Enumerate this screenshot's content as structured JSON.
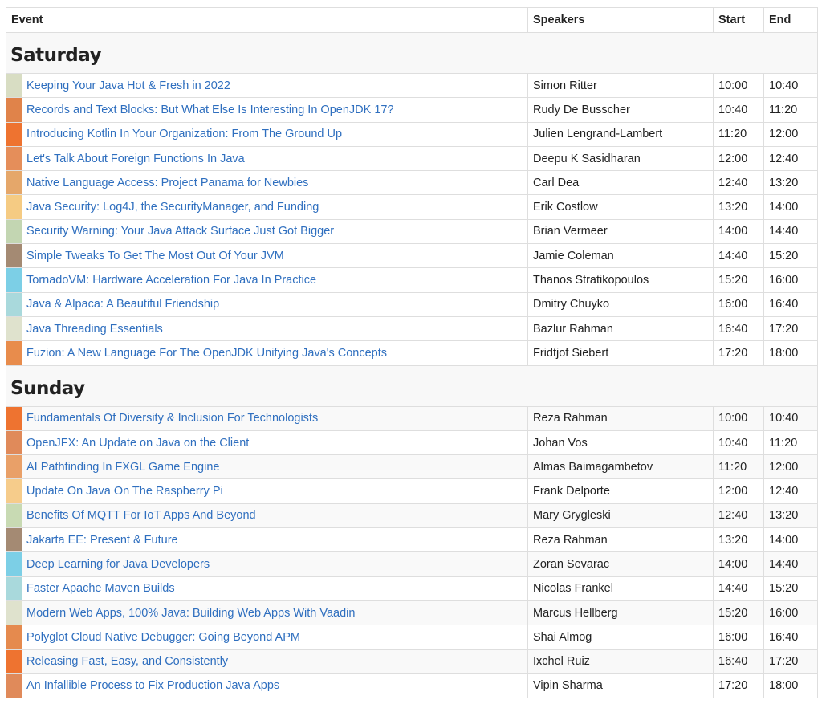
{
  "headers": {
    "event": "Event",
    "speakers": "Speakers",
    "start": "Start",
    "end": "End"
  },
  "days": [
    {
      "name": "Saturday",
      "events": [
        {
          "title": "Keeping Your Java Hot & Fresh in 2022",
          "speaker": "Simon Ritter",
          "start": "10:00",
          "end": "10:40",
          "color": "#d8ddc3"
        },
        {
          "title": "Records and Text Blocks: But What Else Is Interesting In OpenJDK 17?",
          "speaker": "Rudy De Busscher",
          "start": "10:40",
          "end": "11:20",
          "color": "#e0834a"
        },
        {
          "title": "Introducing Kotlin In Your Organization: From The Ground Up",
          "speaker": "Julien Lengrand-Lambert",
          "start": "11:20",
          "end": "12:00",
          "color": "#ee7330"
        },
        {
          "title": "Let's Talk About Foreign Functions In Java",
          "speaker": "Deepu K Sasidharan",
          "start": "12:00",
          "end": "12:40",
          "color": "#e58e5a"
        },
        {
          "title": "Native Language Access: Project Panama for Newbies",
          "speaker": "Carl Dea",
          "start": "12:40",
          "end": "13:20",
          "color": "#e5a76a"
        },
        {
          "title": "Java Security: Log4J, the SecurityManager, and Funding",
          "speaker": "Erik Costlow",
          "start": "13:20",
          "end": "14:00",
          "color": "#f5cb83"
        },
        {
          "title": "Security Warning: Your Java Attack Surface Just Got Bigger",
          "speaker": "Brian Vermeer",
          "start": "14:00",
          "end": "14:40",
          "color": "#c3d6b2"
        },
        {
          "title": "Simple Tweaks To Get The Most Out Of Your JVM",
          "speaker": "Jamie Coleman",
          "start": "14:40",
          "end": "15:20",
          "color": "#a48a73"
        },
        {
          "title": "TornadoVM: Hardware Acceleration For Java In Practice",
          "speaker": "Thanos Stratikopoulos",
          "start": "15:20",
          "end": "16:00",
          "color": "#7ccfe6"
        },
        {
          "title": "Java & Alpaca: A Beautiful Friendship",
          "speaker": "Dmitry Chuyko",
          "start": "16:00",
          "end": "16:40",
          "color": "#a9d9dc"
        },
        {
          "title": "Java Threading Essentials",
          "speaker": "Bazlur Rahman",
          "start": "16:40",
          "end": "17:20",
          "color": "#dfe2cd"
        },
        {
          "title": "Fuzion: A New Language For The OpenJDK Unifying Java's Concepts",
          "speaker": "Fridtjof Siebert",
          "start": "17:20",
          "end": "18:00",
          "color": "#e88c4c"
        }
      ]
    },
    {
      "name": "Sunday",
      "events": [
        {
          "title": "Fundamentals Of Diversity & Inclusion For Technologists",
          "speaker": "Reza Rahman",
          "start": "10:00",
          "end": "10:40",
          "color": "#ee7330"
        },
        {
          "title": "OpenJFX: An Update on Java on the Client",
          "speaker": "Johan Vos",
          "start": "10:40",
          "end": "11:20",
          "color": "#e08a5a"
        },
        {
          "title": "AI Pathfinding In FXGL Game Engine",
          "speaker": "Almas Baimagambetov",
          "start": "11:20",
          "end": "12:00",
          "color": "#e9a068"
        },
        {
          "title": "Update On Java On The Raspberry Pi",
          "speaker": "Frank Delporte",
          "start": "12:00",
          "end": "12:40",
          "color": "#f6cc8b"
        },
        {
          "title": "Benefits Of MQTT For IoT Apps And Beyond",
          "speaker": "Mary Grygleski",
          "start": "12:40",
          "end": "13:20",
          "color": "#c8dab3"
        },
        {
          "title": "Jakarta EE: Present & Future",
          "speaker": "Reza Rahman",
          "start": "13:20",
          "end": "14:00",
          "color": "#a48a73"
        },
        {
          "title": "Deep Learning for Java Developers",
          "speaker": "Zoran Sevarac",
          "start": "14:00",
          "end": "14:40",
          "color": "#7ccfe6"
        },
        {
          "title": "Faster Apache Maven Builds",
          "speaker": "Nicolas Frankel",
          "start": "14:40",
          "end": "15:20",
          "color": "#a9d9dc"
        },
        {
          "title": "Modern Web Apps, 100% Java: Building Web Apps With Vaadin",
          "speaker": "Marcus Hellberg",
          "start": "15:20",
          "end": "16:00",
          "color": "#dfe2cd"
        },
        {
          "title": "Polyglot Cloud Native Debugger: Going Beyond APM",
          "speaker": "Shai Almog",
          "start": "16:00",
          "end": "16:40",
          "color": "#e58a4e"
        },
        {
          "title": "Releasing Fast, Easy, and Consistently",
          "speaker": "Ixchel Ruiz",
          "start": "16:40",
          "end": "17:20",
          "color": "#ee7330"
        },
        {
          "title": "An Infallible Process to Fix Production Java Apps",
          "speaker": "Vipin Sharma",
          "start": "17:20",
          "end": "18:00",
          "color": "#e08a5a"
        }
      ]
    }
  ]
}
